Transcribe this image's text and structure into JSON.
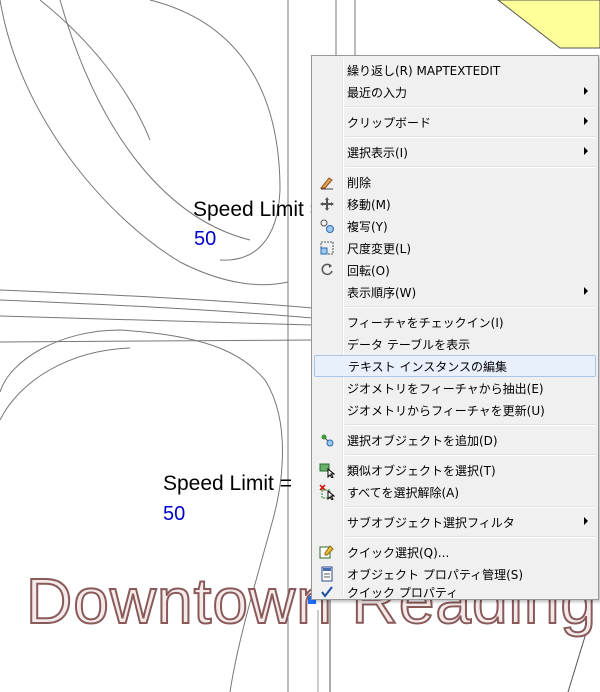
{
  "map": {
    "labels": [
      {
        "text": "Speed Limit =",
        "value": "50"
      },
      {
        "text": "Speed Limit =",
        "value": "50"
      }
    ],
    "area_label": "Downtown Reading"
  },
  "menu": {
    "items": [
      {
        "label": "繰り返し(R) MAPTEXTEDIT",
        "icon": "",
        "submenu": false
      },
      {
        "label": "最近の入力",
        "icon": "",
        "submenu": true
      },
      {
        "label": "クリップボード",
        "icon": "",
        "submenu": true
      },
      {
        "label": "選択表示(I)",
        "icon": "",
        "submenu": true
      },
      {
        "label": "削除",
        "icon": "eraser-icon",
        "submenu": false
      },
      {
        "label": "移動(M)",
        "icon": "move-icon",
        "submenu": false
      },
      {
        "label": "複写(Y)",
        "icon": "copy-icon",
        "submenu": false
      },
      {
        "label": "尺度変更(L)",
        "icon": "scale-icon",
        "submenu": false
      },
      {
        "label": "回転(O)",
        "icon": "rotate-icon",
        "submenu": false
      },
      {
        "label": "表示順序(W)",
        "icon": "",
        "submenu": true
      },
      {
        "label": "フィーチャをチェックイン(I)",
        "icon": "",
        "submenu": false
      },
      {
        "label": "データ テーブルを表示",
        "icon": "",
        "submenu": false
      },
      {
        "label": "テキスト インスタンスの編集",
        "icon": "",
        "submenu": false
      },
      {
        "label": "ジオメトリをフィーチャから抽出(E)",
        "icon": "",
        "submenu": false
      },
      {
        "label": "ジオメトリからフィーチャを更新(U)",
        "icon": "",
        "submenu": false
      },
      {
        "label": "選択オブジェクトを追加(D)",
        "icon": "add-selected-icon",
        "submenu": false
      },
      {
        "label": "類似オブジェクトを選択(T)",
        "icon": "select-similar-icon",
        "submenu": false
      },
      {
        "label": "すべてを選択解除(A)",
        "icon": "deselect-all-icon",
        "submenu": false
      },
      {
        "label": "サブオブジェクト選択フィルタ",
        "icon": "",
        "submenu": true
      },
      {
        "label": "クイック選択(Q)...",
        "icon": "quick-select-icon",
        "submenu": false
      },
      {
        "label": "オブジェクト プロパティ管理(S)",
        "icon": "properties-icon",
        "submenu": false
      },
      {
        "label": "クイック プロパティ",
        "icon": "checkmark-icon",
        "submenu": false
      }
    ]
  },
  "colors": {
    "menu_bg": "#f0f0f0",
    "highlight": "#e8f0fb",
    "highlight_border": "#a9c6ea",
    "label_value": "#0000cc",
    "parcel_yellow": "#ffff99"
  }
}
